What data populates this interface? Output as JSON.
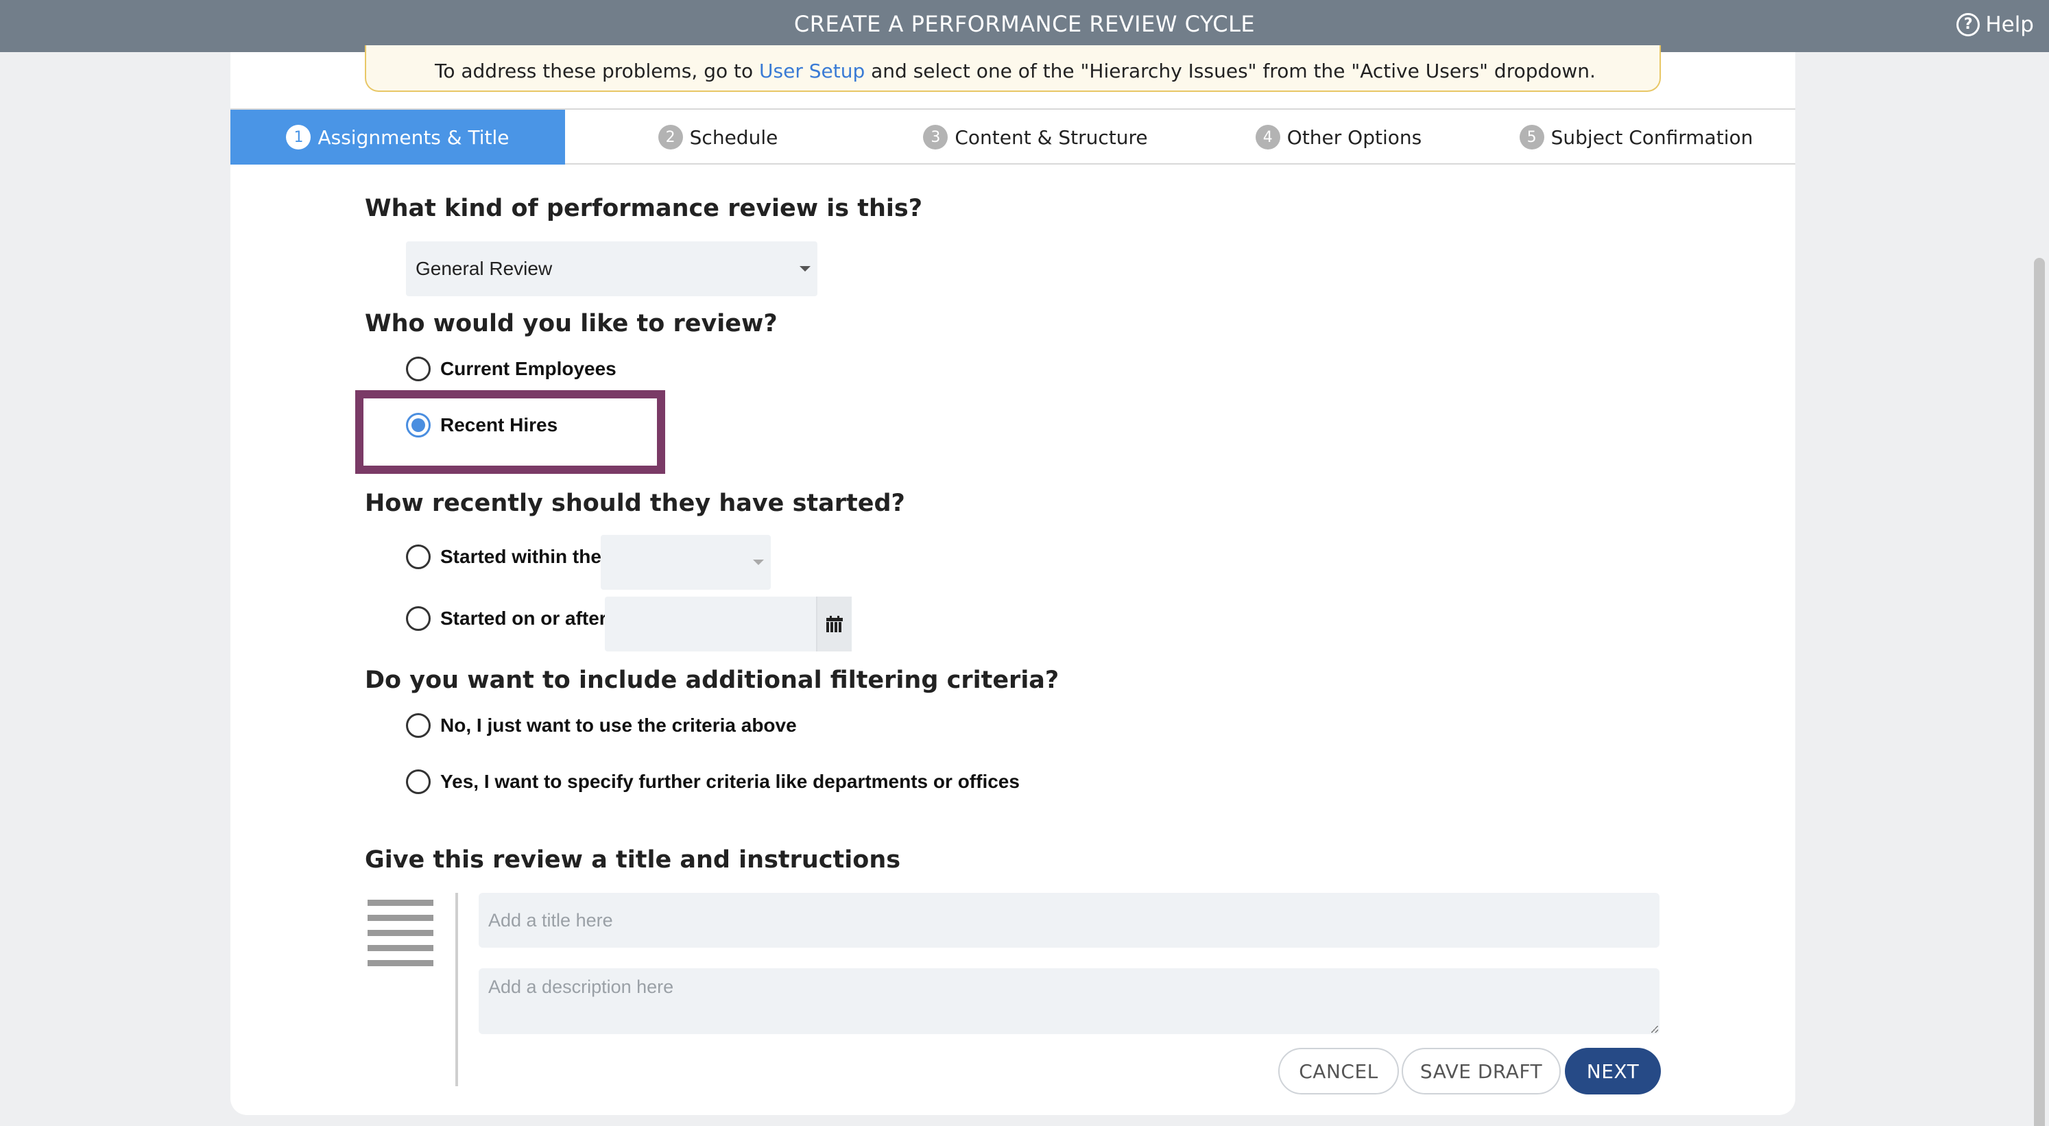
{
  "header": {
    "title": "CREATE A PERFORMANCE REVIEW CYCLE",
    "help_label": "Help",
    "help_icon": "question-circle-icon"
  },
  "warning": {
    "text_before": "To address these problems, go to ",
    "link_text": "User Setup",
    "text_after": " and select one of the \"Hierarchy Issues\" from the \"Active Users\" dropdown."
  },
  "steps": [
    {
      "num": "1",
      "label": "Assignments & Title",
      "active": true
    },
    {
      "num": "2",
      "label": "Schedule",
      "active": false
    },
    {
      "num": "3",
      "label": "Content & Structure",
      "active": false
    },
    {
      "num": "4",
      "label": "Other Options",
      "active": false
    },
    {
      "num": "5",
      "label": "Subject Confirmation",
      "active": false
    }
  ],
  "review_type": {
    "question": "What kind of performance review is this?",
    "selected": "General Review"
  },
  "who": {
    "question": "Who would you like to review?",
    "options": [
      "Current Employees",
      "Recent Hires"
    ],
    "selected": "Recent Hires"
  },
  "recency": {
    "question": "How recently should they have started?",
    "within_label": "Started within the",
    "within_value": "",
    "on_after_label": "Started on or after",
    "date_value": ""
  },
  "filtering": {
    "question": "Do you want to include additional filtering criteria?",
    "options": [
      "No, I just want to use the criteria above",
      "Yes, I want to specify further criteria like departments or offices"
    ]
  },
  "title_section": {
    "question": "Give this review a title and instructions",
    "title_placeholder": "Add a title here",
    "description_placeholder": "Add a description here"
  },
  "buttons": {
    "cancel": "CANCEL",
    "save_draft": "SAVE DRAFT",
    "next": "NEXT"
  },
  "colors": {
    "header_bg": "#727e8a",
    "active_step": "#4a95e6",
    "primary_button": "#264a86",
    "highlight_border": "#7a3a66",
    "radio_selected": "#4a8ee0"
  }
}
